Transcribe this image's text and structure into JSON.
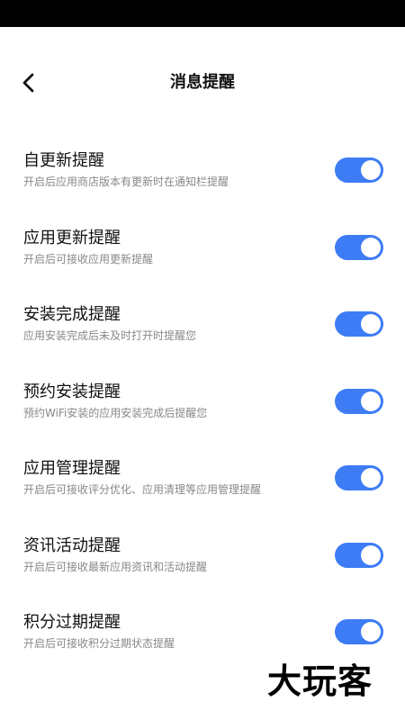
{
  "header": {
    "title": "消息提醒",
    "back_icon": "chevron-left-icon"
  },
  "accent_color": "#3d7cf5",
  "items": [
    {
      "title": "自更新提醒",
      "subtitle": "开启后应用商店版本有更新时在通知栏提醒",
      "enabled": true
    },
    {
      "title": "应用更新提醒",
      "subtitle": "开启后可接收应用更新提醒",
      "enabled": true
    },
    {
      "title": "安装完成提醒",
      "subtitle": "应用安装完成后未及时打开时提醒您",
      "enabled": true
    },
    {
      "title": "预约安装提醒",
      "subtitle": "预约WiFi安装的应用安装完成后提醒您",
      "enabled": true
    },
    {
      "title": "应用管理提醒",
      "subtitle": "开启后可接收评分优化、应用清理等应用管理提醒",
      "enabled": true
    },
    {
      "title": "资讯活动提醒",
      "subtitle": "开启后可接收最新应用资讯和活动提醒",
      "enabled": true
    },
    {
      "title": "积分过期提醒",
      "subtitle": "开启后可接收积分过期状态提醒",
      "enabled": true
    }
  ],
  "watermark": "大玩客"
}
